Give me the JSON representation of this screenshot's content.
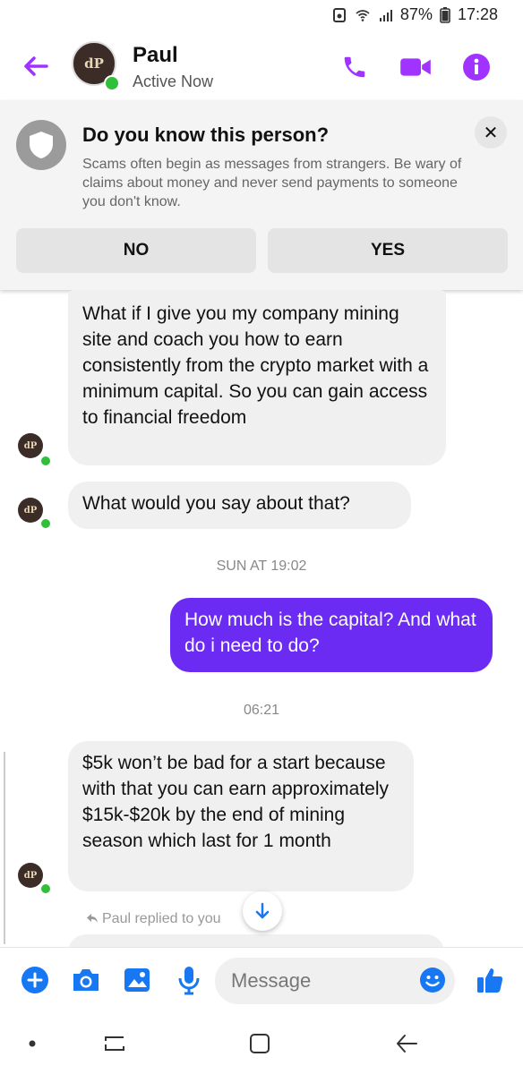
{
  "status_bar": {
    "battery": "87%",
    "time": "17:28"
  },
  "header": {
    "name": "Paul",
    "status": "Active Now",
    "avatar_monogram": "dP"
  },
  "warning": {
    "title": "Do you know this person?",
    "body": "Scams often begin as messages from strangers. Be wary of claims about money and never send payments to someone you don't know.",
    "no_label": "NO",
    "yes_label": "YES",
    "close_symbol": "✕"
  },
  "messages": [
    {
      "from": "Paul",
      "text": "What if I give you my company mining site and coach you how to earn consistently from the crypto market with a minimum capital. So you can gain access to financial freedom"
    },
    {
      "from": "Paul",
      "text": "What would you say about that?"
    },
    {
      "type": "timestamp",
      "text": "SUN AT 19:02"
    },
    {
      "from": "me",
      "text": "How much is the capital? And what do i need to do?"
    },
    {
      "type": "timestamp",
      "text": "06:21"
    },
    {
      "from": "Paul",
      "text": "$5k won’t be bad for a start because with that you can earn approximately $15k-$20k by the end of mining season which last for 1 month"
    }
  ],
  "reply_note": "Paul replied to you",
  "composer": {
    "placeholder": "Message"
  },
  "colors": {
    "accent": "#a033ff",
    "bubble_out": "#6c2bf2",
    "bubble_in": "#f0f0f0",
    "composer_icon": "#1877f2",
    "online": "#2fbf3a"
  },
  "icons": [
    "back-arrow-icon",
    "phone-icon",
    "video-icon",
    "info-icon",
    "shield-icon",
    "close-icon",
    "plus-icon",
    "camera-icon",
    "image-icon",
    "mic-icon",
    "emoji-icon",
    "thumbs-up-icon",
    "scroll-down-icon"
  ]
}
